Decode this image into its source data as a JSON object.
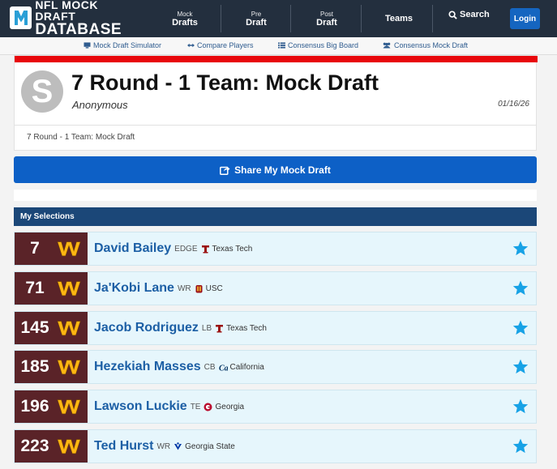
{
  "brand": {
    "line1": "NFL MOCK DRAFT",
    "line2": "DATABASE",
    "logo_icon": "mdd-logo-icon"
  },
  "nav": {
    "items": [
      {
        "small": "Mock",
        "big": "Drafts"
      },
      {
        "small": "Pre",
        "big": "Draft"
      },
      {
        "small": "Post",
        "big": "Draft"
      },
      {
        "small": "",
        "big": "Teams"
      }
    ],
    "search_label": "Search",
    "login_label": "Login"
  },
  "subnav": [
    {
      "label": "Mock Draft Simulator",
      "icon": "monitor-icon"
    },
    {
      "label": "Compare Players",
      "icon": "arrows-icon"
    },
    {
      "label": "Consensus Big Board",
      "icon": "list-icon"
    },
    {
      "label": "Consensus Mock Draft",
      "icon": "users-icon"
    }
  ],
  "draft": {
    "avatar_letter": "S",
    "title": "7 Round - 1 Team: Mock Draft",
    "author": "Anonymous",
    "date": "01/16/26",
    "breadcrumb": "7 Round - 1 Team: Mock Draft"
  },
  "share_label": "Share My Mock Draft",
  "selections_header": "My Selections",
  "colors": {
    "nav_bg": "#232f3e",
    "accent_red": "#e8070b",
    "share_blue": "#0d60c6",
    "header_blue": "#1b4778",
    "team_burgundy": "#5a2328",
    "team_gold": "#ffb612",
    "row_bg": "#e6f6fc",
    "name_blue": "#1c5fa5",
    "star_blue": "#17a2e6"
  },
  "picks": [
    {
      "pick": "7",
      "name": "David Bailey",
      "position": "EDGE",
      "school": "Texas Tech",
      "school_icon": "texas-tech-icon"
    },
    {
      "pick": "71",
      "name": "Ja'Kobi Lane",
      "position": "WR",
      "school": "USC",
      "school_icon": "usc-icon"
    },
    {
      "pick": "145",
      "name": "Jacob Rodriguez",
      "position": "LB",
      "school": "Texas Tech",
      "school_icon": "texas-tech-icon"
    },
    {
      "pick": "185",
      "name": "Hezekiah Masses",
      "position": "CB",
      "school": "California",
      "school_icon": "cal-icon"
    },
    {
      "pick": "196",
      "name": "Lawson Luckie",
      "position": "TE",
      "school": "Georgia",
      "school_icon": "georgia-icon"
    },
    {
      "pick": "223",
      "name": "Ted Hurst",
      "position": "WR",
      "school": "Georgia State",
      "school_icon": "georgia-state-icon"
    }
  ]
}
